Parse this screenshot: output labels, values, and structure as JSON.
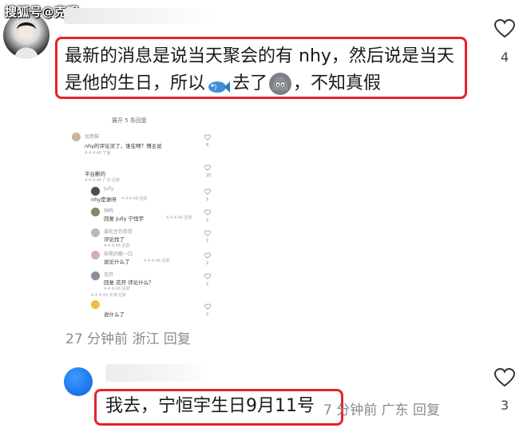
{
  "watermark": "搜狐号@克观",
  "comment1": {
    "line1": "最新的消息是说当天聚会的有 nhy，然后说是当天",
    "line2_a": "是他的生日，所以",
    "line2_b": "去了",
    "line2_c": "，不知真假",
    "likes": "4",
    "meta": "27 分钟前  浙江  回复"
  },
  "mini_screenshot": {
    "header": "展开 5 条回复",
    "rows": [
      {
        "name": "如意猫",
        "text": "nhy的评论没了，谁在啊？博主说",
        "meta": "4-4 4:46  宁夏",
        "count": "8"
      },
      {
        "name": "",
        "text": "平台删的",
        "meta": "4-4 4:46  广东  回复",
        "count": "20"
      },
      {
        "name": "Jully",
        "text": "nhy是谁呀",
        "meta": "4-4 4:48  回复",
        "count": "1"
      },
      {
        "name": "钟鸣",
        "text": "回复  Jully  宁恒宇",
        "meta": "4-4 4:48  回复",
        "count": "2"
      },
      {
        "name": "爱吃豆包卷卷",
        "text": "评论找了",
        "meta": "4-4 4:48  回复",
        "count": "1"
      },
      {
        "name": "抹茶奶酪一口",
        "text": "说论什么了",
        "meta": "4-4 4:48  回复",
        "count": "2"
      },
      {
        "name": "花开",
        "text": "回复  花开  评论什么？",
        "meta": "4-4 4:48  回复",
        "count": "2"
      },
      {
        "name": "",
        "text": "说什么了",
        "meta": "4-4 4:48  天津  回复",
        "count": "2"
      }
    ]
  },
  "comment2": {
    "highlight": "我去，宁恒宇生日9月11号",
    "meta_tail": "7 分钟前  广东  回复",
    "likes": "3"
  },
  "colors": {
    "highlight_border": "#e4232d",
    "blue_avatar": "#1a73e8"
  },
  "icons": {
    "heart": "heart-outline-icon",
    "fish": "fish-emoji-icon",
    "rock": "rock-face-emoji-icon"
  }
}
